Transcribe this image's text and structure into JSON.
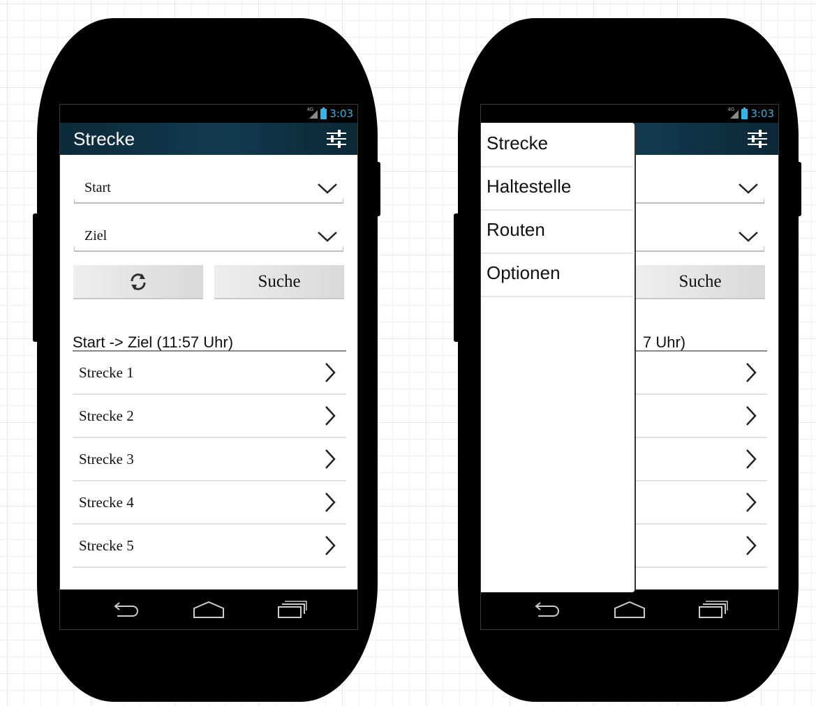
{
  "status_bar": {
    "network": "4G",
    "time": "3:03"
  },
  "app": {
    "title": "Strecke"
  },
  "form": {
    "start_label": "Start",
    "ziel_label": "Ziel",
    "search_label": "Suche"
  },
  "results": {
    "header": "Start -> Ziel (11:57 Uhr)",
    "header_partial": "7 Uhr)",
    "items": [
      "Strecke 1",
      "Strecke 2",
      "Strecke 3",
      "Strecke 4",
      "Strecke 5"
    ]
  },
  "drawer": {
    "items": [
      "Strecke",
      "Haltestelle",
      "Routen",
      "Optionen"
    ]
  },
  "colors": {
    "actionbar": "#123a4e",
    "status_accent": "#33b5e5",
    "phone_body": "#000000"
  },
  "icons": [
    "settings-sliders-icon",
    "chevron-down-icon",
    "refresh-icon",
    "chevron-right-icon",
    "back-icon",
    "home-icon",
    "recents-icon",
    "signal-icon",
    "battery-icon"
  ]
}
